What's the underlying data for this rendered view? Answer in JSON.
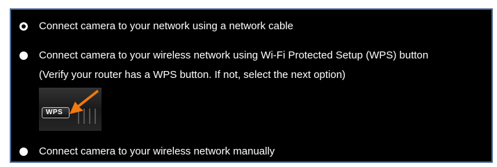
{
  "options": [
    {
      "label": "Connect camera to your network using a network cable",
      "selected": true
    },
    {
      "label": "Connect camera to your wireless network using Wi-Fi Protected Setup (WPS) button",
      "note": "(Verify your router has a WPS button. If not, select the next option)",
      "selected": false
    },
    {
      "label": "Connect camera to your wireless network manually",
      "selected": false
    }
  ],
  "wps_image": {
    "button_text": "WPS",
    "arrow_color": "#f07a10"
  },
  "colors": {
    "panel_bg": "#000000",
    "panel_border": "#4f6c96",
    "text": "#ffffff"
  }
}
